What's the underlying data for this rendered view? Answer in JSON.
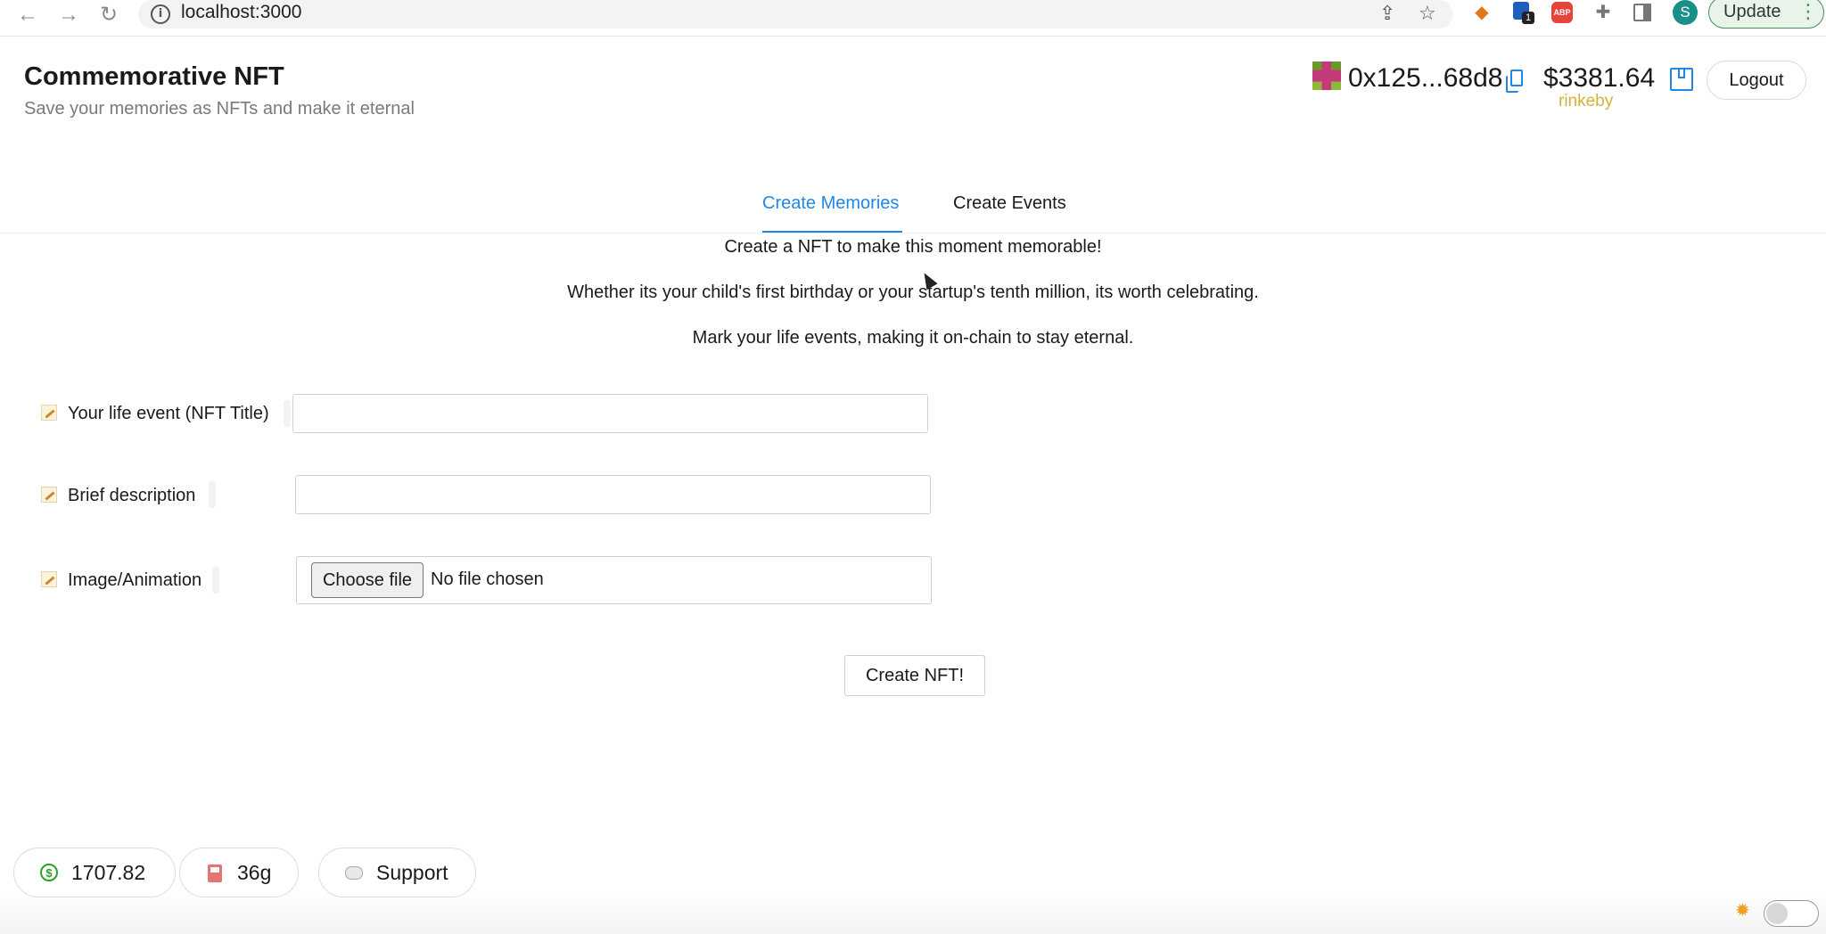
{
  "browser": {
    "url": "localhost:3000",
    "extension_badge": "1",
    "abp_label": "ABP",
    "profile_initial": "S",
    "update_label": "Update",
    "back_glyph": "←",
    "forward_glyph": "→",
    "reload_glyph": "↻",
    "icons": [
      "back-icon",
      "forward-icon",
      "reload-icon",
      "info-icon",
      "share-icon",
      "star-icon",
      "metamask-fox-icon",
      "extension-icon",
      "abp-icon",
      "puzzle-icon",
      "sidepanel-icon",
      "menu-icon"
    ]
  },
  "header": {
    "title": "Commemorative NFT",
    "subtitle": "Save your memories as NFTs and make it eternal",
    "wallet": {
      "address": "0x125...68d8",
      "balance": "$3381.64",
      "network": "rinkeby",
      "network_color": "#d4b13a"
    },
    "logout_label": "Logout"
  },
  "tabs": [
    {
      "label": "Create Memories",
      "active": true
    },
    {
      "label": "Create Events",
      "active": false
    }
  ],
  "intro": {
    "line1": "Create a NFT to make this moment memorable!",
    "line2": "Whether its your child's first birthday or your startup's tenth million, its worth celebrating.",
    "line3": "Mark your life events, making it on-chain to stay eternal."
  },
  "form": {
    "title_label": "Your life event (NFT Title)",
    "title_value": "",
    "description_label": "Brief description",
    "description_value": "",
    "image_label": "Image/Animation",
    "choose_file_label": "Choose file",
    "no_file_text": "No file chosen",
    "submit_label": "Create NFT!"
  },
  "footer": {
    "price": "1707.82",
    "gas": "36g",
    "support_label": "Support",
    "theme_toggle_on": false
  },
  "colors": {
    "accent": "#1e88e5",
    "price_green": "#2ca02c",
    "update_green": "#4a8d5a"
  }
}
